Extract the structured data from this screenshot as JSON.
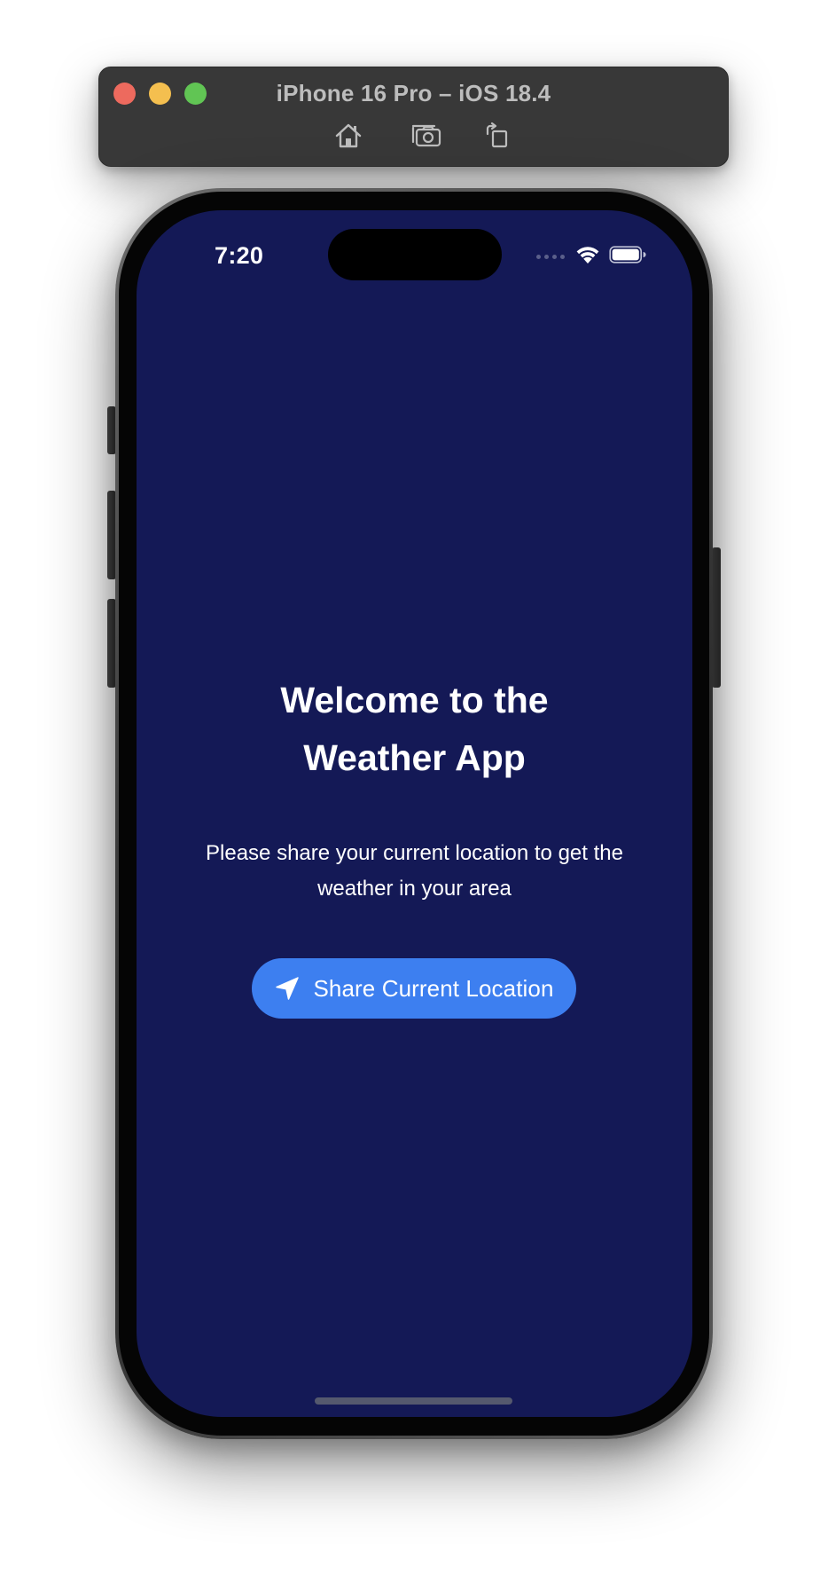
{
  "simulator": {
    "title": "iPhone 16 Pro – iOS 18.4",
    "toolbar": {
      "home_icon": "home-icon",
      "screenshot_icon": "camera-icon",
      "rotate_icon": "rotate-icon"
    }
  },
  "status_bar": {
    "time": "7:20",
    "icons": [
      "cellular-dots-icon",
      "wifi-icon",
      "battery-icon"
    ]
  },
  "welcome": {
    "title_line1": "Welcome to the",
    "title_line2": "Weather App",
    "subtitle_line1": "Please share your current location to get the",
    "subtitle_line2": "weather in your area"
  },
  "share_button": {
    "label": "Share Current Location",
    "icon": "location-arrow-icon"
  },
  "colors": {
    "screen_background": "#141956",
    "button_accent": "#3d7ff0",
    "text": "#ffffff"
  }
}
